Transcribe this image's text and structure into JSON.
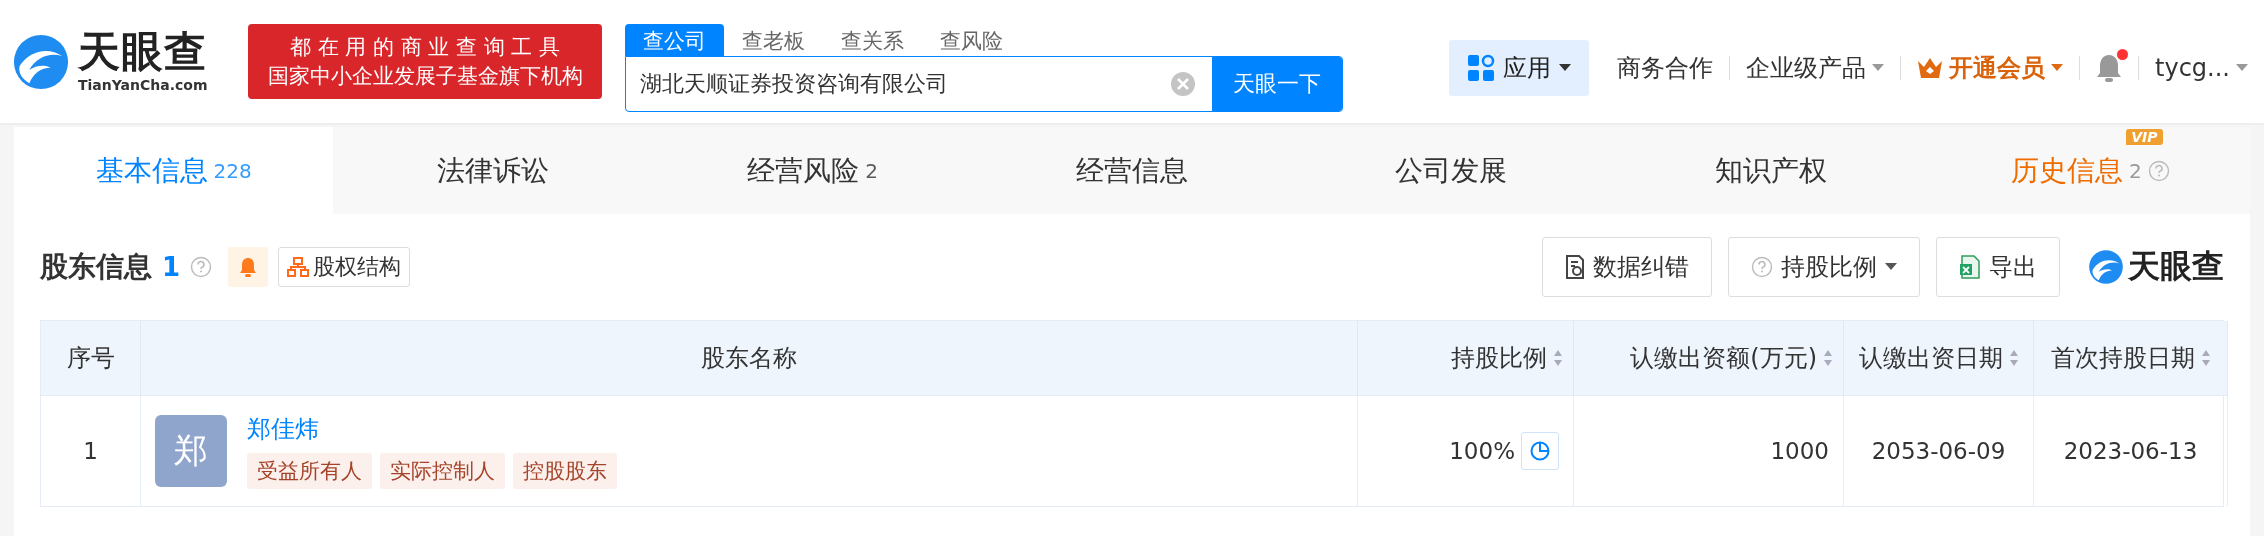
{
  "header": {
    "logo": {
      "name": "天眼查",
      "domain": "TianYanCha.com"
    },
    "banner": [
      "都 在 用 的 商 业 查 询 工 具",
      "国家中小企业发展子基金旗下机构"
    ],
    "search_tabs": [
      {
        "label": "查公司",
        "selected": true
      },
      {
        "label": "查老板",
        "selected": false
      },
      {
        "label": "查关系",
        "selected": false
      },
      {
        "label": "查风险",
        "selected": false
      }
    ],
    "search": {
      "value": "湖北天顺证券投资咨询有限公司",
      "button": "天眼一下"
    },
    "nav": [
      {
        "kind": "apps",
        "label": "应用",
        "selected": true
      },
      {
        "kind": "link",
        "label": "商务合作"
      },
      {
        "kind": "dropdown",
        "label": "企业级产品"
      },
      {
        "kind": "vip",
        "label": "开通会员"
      },
      {
        "kind": "bell",
        "unread": true
      },
      {
        "kind": "dropdown",
        "label": "tycg..."
      }
    ]
  },
  "tabs": [
    {
      "kind": "normal",
      "label": "基本信息",
      "count": "228",
      "selected": true
    },
    {
      "kind": "normal",
      "label": "法律诉讼",
      "selected": false
    },
    {
      "kind": "normal",
      "label": "经营风险",
      "count": "2",
      "selected": false
    },
    {
      "kind": "normal",
      "label": "经营信息",
      "selected": false
    },
    {
      "kind": "normal",
      "label": "公司发展",
      "selected": false
    },
    {
      "kind": "normal",
      "label": "知识产权",
      "selected": false
    },
    {
      "kind": "vip",
      "label": "历史信息",
      "count": "2",
      "badge": "VIP",
      "selected": false
    }
  ],
  "section": {
    "title": "股东信息",
    "count": "1",
    "structure_button": "股权结构",
    "actions": [
      {
        "kind": "correct",
        "label": "数据纠错"
      },
      {
        "kind": "dropdown",
        "label": "持股比例"
      },
      {
        "kind": "export",
        "label": "导出"
      }
    ],
    "brand": "天眼查"
  },
  "table": {
    "columns": [
      {
        "label": "序号",
        "sortable": false
      },
      {
        "label": "股东名称",
        "sortable": false
      },
      {
        "label": "持股比例",
        "sortable": true
      },
      {
        "label": "认缴出资额(万元)",
        "sortable": true
      },
      {
        "label": "认缴出资日期",
        "sortable": true
      },
      {
        "label": "首次持股日期",
        "sortable": true
      }
    ],
    "rows": [
      {
        "index": "1",
        "avatar": "郑",
        "name": "郑佳炜",
        "tags": [
          "受益所有人",
          "实际控制人",
          "控股股东"
        ],
        "ratio": "100%",
        "capital": "1000",
        "date_paid": "2053-06-09",
        "date_first": "2023-06-13"
      }
    ]
  }
}
